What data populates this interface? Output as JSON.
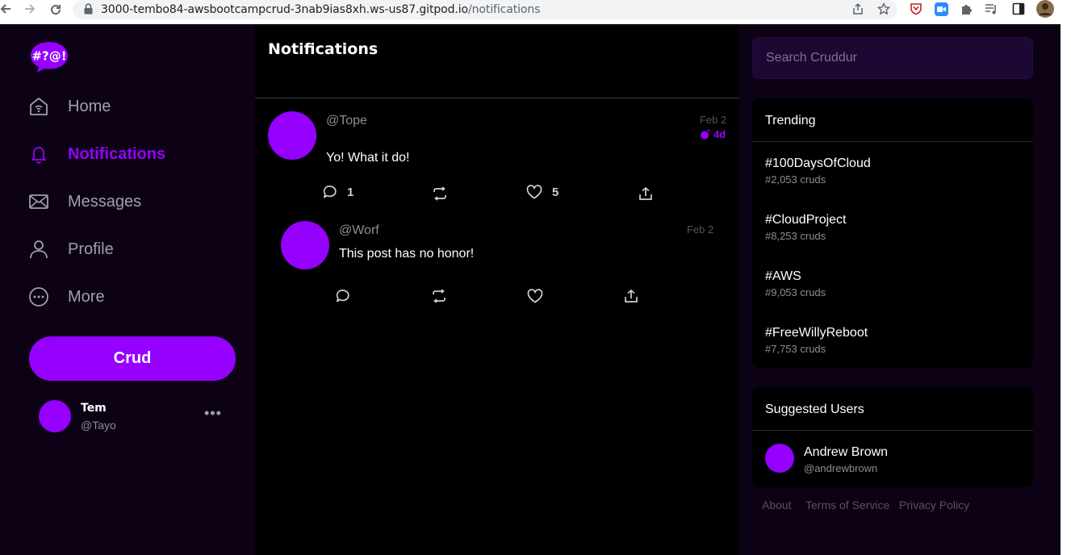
{
  "browser": {
    "url_host": "3000-tembo84-awsbootcampcrud-3nab9ias8xh.ws-us87.gitpod.io",
    "url_path": "/notifications"
  },
  "logo": {
    "text": "#?@!"
  },
  "sidebar": {
    "items": [
      {
        "label": "Home",
        "icon": "home-icon"
      },
      {
        "label": "Notifications",
        "icon": "bell-icon",
        "active": true
      },
      {
        "label": "Messages",
        "icon": "envelope-icon"
      },
      {
        "label": "Profile",
        "icon": "person-icon"
      },
      {
        "label": "More",
        "icon": "more-circle-icon"
      }
    ],
    "crud_button": "Crud",
    "profile": {
      "name": "Tem",
      "handle": "@Tayo",
      "more": "•••"
    }
  },
  "feed": {
    "title": "Notifications",
    "activities": [
      {
        "handle": "@Tope",
        "message": "Yo! What it do!",
        "date": "Feb 2",
        "expires": "4d",
        "replies": "1",
        "likes": "5"
      },
      {
        "handle": "@Worf",
        "message": "This post has no honor!",
        "date": "Feb 2"
      }
    ]
  },
  "search": {
    "placeholder": "Search Cruddur"
  },
  "trending": {
    "title": "Trending",
    "items": [
      {
        "tag": "#100DaysOfCloud",
        "count": "#2,053 cruds"
      },
      {
        "tag": "#CloudProject",
        "count": "#8,253 cruds"
      },
      {
        "tag": "#AWS",
        "count": "#9,053 cruds"
      },
      {
        "tag": "#FreeWillyReboot",
        "count": "#7,753 cruds"
      }
    ]
  },
  "suggested": {
    "title": "Suggested Users",
    "users": [
      {
        "name": "Andrew Brown",
        "handle": "@andrewbrown"
      }
    ]
  },
  "footer": {
    "about": "About",
    "terms": "Terms of Service",
    "privacy": "Privacy Policy"
  },
  "colors": {
    "accent": "#9500ff",
    "background": "#0d0115",
    "feed_background": "#000000"
  }
}
